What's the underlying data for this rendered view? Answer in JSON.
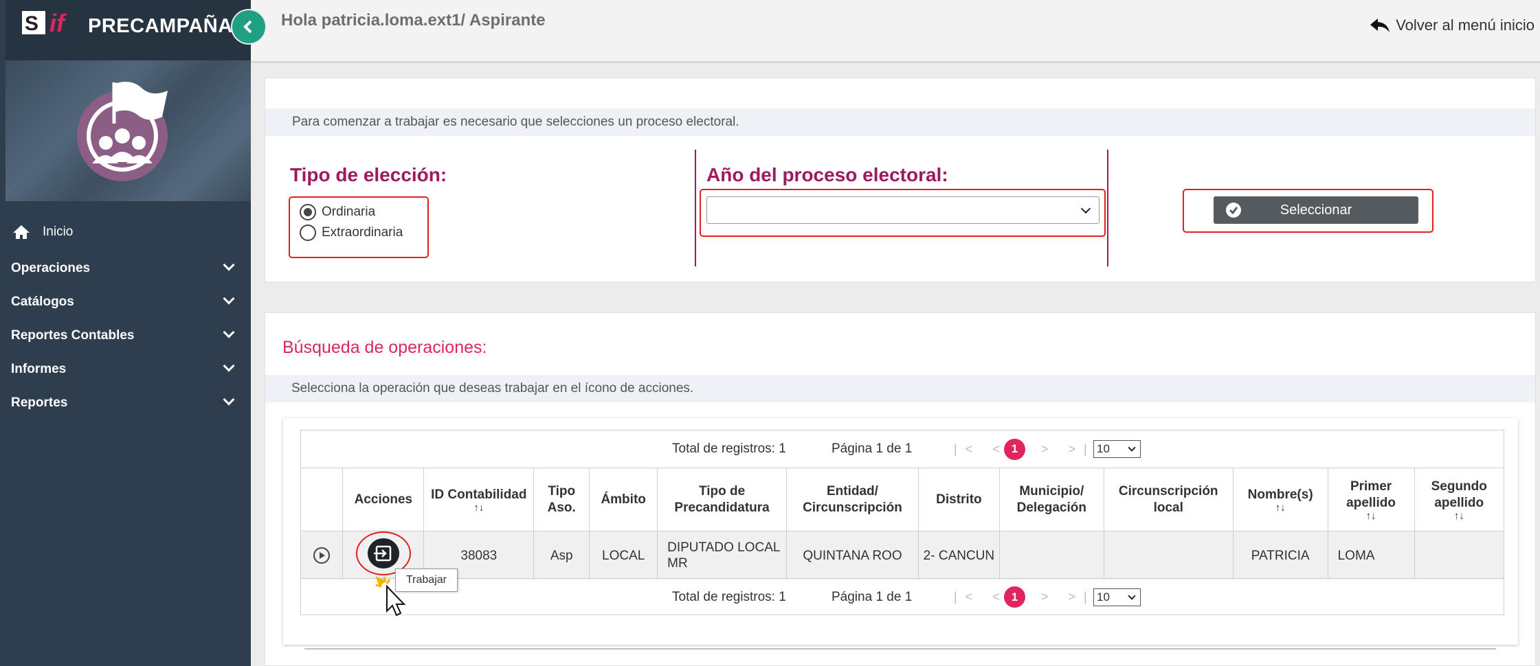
{
  "app": {
    "title": "PRECAMPAÑA",
    "logo_text": "SIF"
  },
  "header": {
    "greeting": "Hola patricia.loma.ext1/ Aspirante",
    "back_label": "Volver al menú inicio"
  },
  "sidebar": {
    "items": [
      {
        "label": "Inicio"
      },
      {
        "label": "Operaciones"
      },
      {
        "label": "Catálogos"
      },
      {
        "label": "Reportes Contables"
      },
      {
        "label": "Informes"
      },
      {
        "label": "Reportes"
      }
    ]
  },
  "process_card": {
    "info": "Para comenzar a trabajar es necesario que selecciones un proceso electoral.",
    "election_type_label": "Tipo de elección:",
    "options": [
      {
        "label": "Ordinaria",
        "checked": true
      },
      {
        "label": "Extraordinaria",
        "checked": false
      }
    ],
    "year_label": "Año del proceso electoral:",
    "year_value": "",
    "select_button": "Seleccionar"
  },
  "search_card": {
    "title": "Búsqueda de operaciones:",
    "info": "Selecciona la operación que deseas trabajar en el ícono de acciones.",
    "pager": {
      "total": "Total de registros: 1",
      "page": "Página 1 de 1",
      "current": "1",
      "page_size": "10",
      "first_prev": "|< <",
      "next_last": "> >|"
    },
    "columns": [
      "Acciones",
      "ID Contabilidad",
      "Tipo Aso.",
      "Ámbito",
      "Tipo de Precandidatura",
      "Entidad/ Circunscripción",
      "Distrito",
      "Municipio/ Delegación",
      "Circunscripción local",
      "Nombre(s)",
      "Primer apellido",
      "Segundo apellido"
    ],
    "sort_symbol": "↑↓",
    "rows": [
      {
        "id": "38083",
        "tipo": "Asp",
        "ambito": "LOCAL",
        "precandidatura": "DIPUTADO LOCAL MR",
        "entidad": "QUINTANA ROO",
        "distrito": "2- CANCUN",
        "municipio": "",
        "circ_local": "",
        "nombre": "PATRICIA",
        "primer": "LOMA",
        "segundo": ""
      }
    ],
    "tooltip": "Trabajar"
  },
  "colors": {
    "sidebar": "#2e3e4e",
    "accent": "#a0185e",
    "pink": "#e0245e",
    "green": "#1fa083",
    "highlight": "#e02020"
  }
}
